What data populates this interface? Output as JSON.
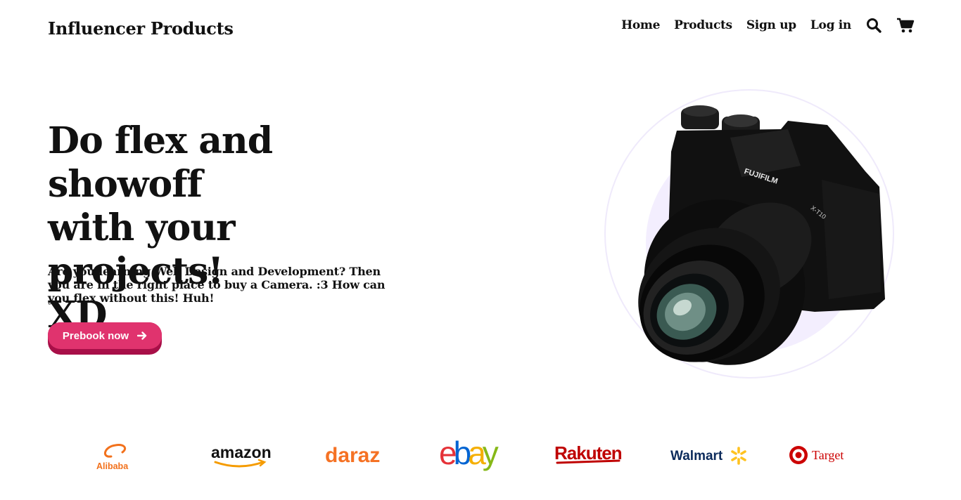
{
  "header": {
    "brand": "Influencer Products",
    "nav": [
      "Home",
      "Products",
      "Sign up",
      "Log in"
    ],
    "icons": [
      "search-icon",
      "cart-icon"
    ]
  },
  "hero": {
    "title_lines": [
      "Do flex and showoff",
      "with your projects!",
      "XD"
    ],
    "description": "Are you learning Web Design and Development? Then you are in the right place to buy a Camera. :3 How can you flex without this! Huh!",
    "cta_label": "Prebook now",
    "camera_labels": {
      "brand": "FUJIFILM",
      "model": "X-T10"
    }
  },
  "partners": {
    "alibaba": "Alibaba",
    "amazon": "amazon",
    "daraz": "daraz",
    "ebay": {
      "e": "e",
      "b": "b",
      "a": "a",
      "y": "y"
    },
    "rakuten": "Rakuten",
    "walmart": "Walmart",
    "target": "Target"
  },
  "colors": {
    "text": "#111111",
    "cta": "#e0336e",
    "cta_shadow": "#a80f48",
    "hero_circle": "#f3eefe",
    "alibaba": "#f2711c",
    "daraz": "#f57224",
    "ebay": [
      "#e53238",
      "#0064d2",
      "#f5af02",
      "#86b817"
    ],
    "rakuten": "#bf0000",
    "walmart": "#0b2a5b",
    "walmart_spark": "#ffc220",
    "target": "#cc0000"
  }
}
